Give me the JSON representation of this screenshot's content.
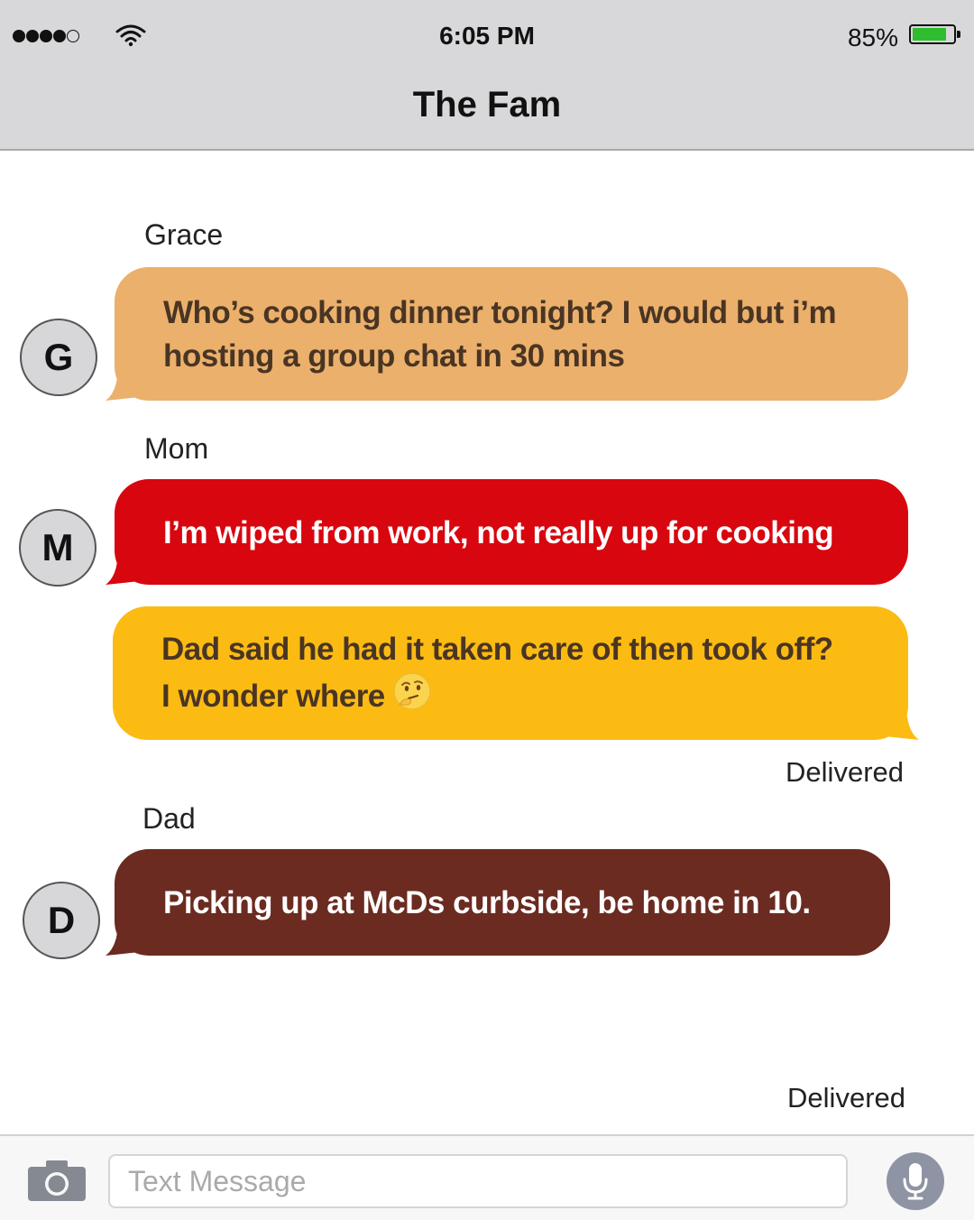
{
  "status_bar": {
    "time": "6:05 PM",
    "battery_percent": "85%",
    "battery_level": 0.85,
    "signal_bars": 4,
    "signal_max": 5,
    "battery_color": "#2ebd2e"
  },
  "header": {
    "title": "The Fam"
  },
  "messages": [
    {
      "sender": "Grace",
      "avatar": "G",
      "text_lines": [
        "Who’s cooking dinner tonight? I would but i’m",
        "hosting a group chat in 30 mins"
      ],
      "bubble_color": "#ebb06b"
    },
    {
      "sender": "Mom",
      "avatar": "M",
      "text_lines": [
        "I’m wiped from work, not really up for cooking"
      ],
      "bubble_color": "#d8060f"
    },
    {
      "sender": "",
      "text_lines": [
        "Dad said he had it taken care of then took off?",
        "I wonder where"
      ],
      "emoji": "thinking-face-icon",
      "bubble_color": "#fbbb12",
      "status": "Delivered"
    },
    {
      "sender": "Dad",
      "avatar": "D",
      "text_lines": [
        "Picking up at McDs curbside, be home in 10."
      ],
      "bubble_color": "#6b2b20",
      "status": "Delivered"
    }
  ],
  "input_bar": {
    "placeholder": "Text Message",
    "value": "",
    "left_icon": "camera-icon",
    "right_icon": "microphone-icon"
  }
}
